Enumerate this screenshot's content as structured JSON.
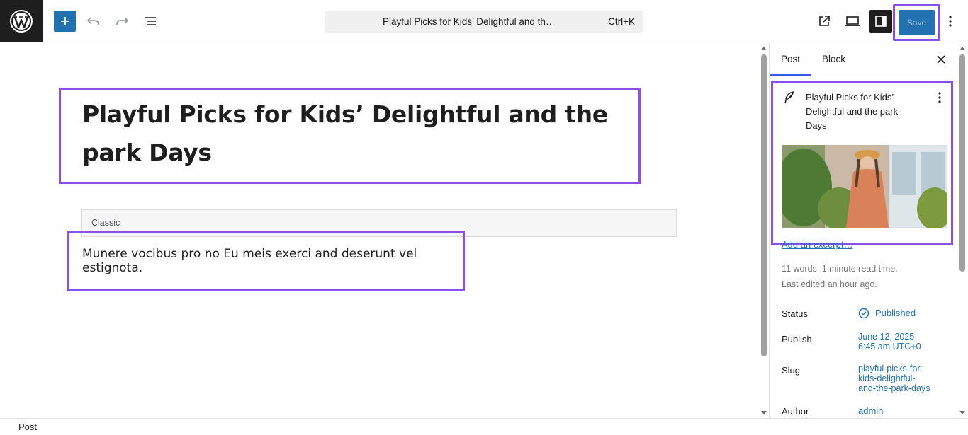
{
  "header": {
    "document_title": "Playful Picks for Kids’ Delightful and th… · Post",
    "shortcut": "Ctrl+K",
    "save_label": "Save"
  },
  "editor": {
    "post_title": "Playful Picks for Kids’ Delightful and the park Days",
    "classic_label": "Classic",
    "paragraph": "Munere vocibus pro no Eu meis exerci and deserunt vel estignota."
  },
  "sidebar": {
    "tabs": [
      {
        "label": "Post",
        "active": true
      },
      {
        "label": "Block",
        "active": false
      }
    ],
    "card_title": "Playful Picks for Kids’ Delightful and the park Days",
    "excerpt_link": "Add an excerpt…",
    "word_count": "11 words, 1 minute read time.",
    "last_edited": "Last edited an hour ago.",
    "rows": {
      "status": {
        "label": "Status",
        "value": "Published"
      },
      "publish": {
        "label": "Publish",
        "value_line1": "June 12, 2025",
        "value_line2": "6:45 am UTC+0"
      },
      "slug": {
        "label": "Slug",
        "value_line1": "playful-picks-for-",
        "value_line2": "kids-delightful-",
        "value_line3": "and-the-park-days"
      },
      "author": {
        "label": "Author",
        "value": "admin"
      }
    }
  },
  "footer": {
    "breadcrumb": "Post"
  },
  "colors": {
    "accent": "#2271b1",
    "highlight": "#8a4fe8",
    "dark": "#1e1e1e"
  },
  "icons": [
    "wordpress-logo-icon",
    "plus-icon",
    "undo-icon",
    "redo-icon",
    "list-view-icon",
    "external-link-icon",
    "desktop-preview-icon",
    "sidebar-settings-icon",
    "more-vertical-icon",
    "close-icon",
    "feather-icon",
    "check-circle-icon"
  ]
}
